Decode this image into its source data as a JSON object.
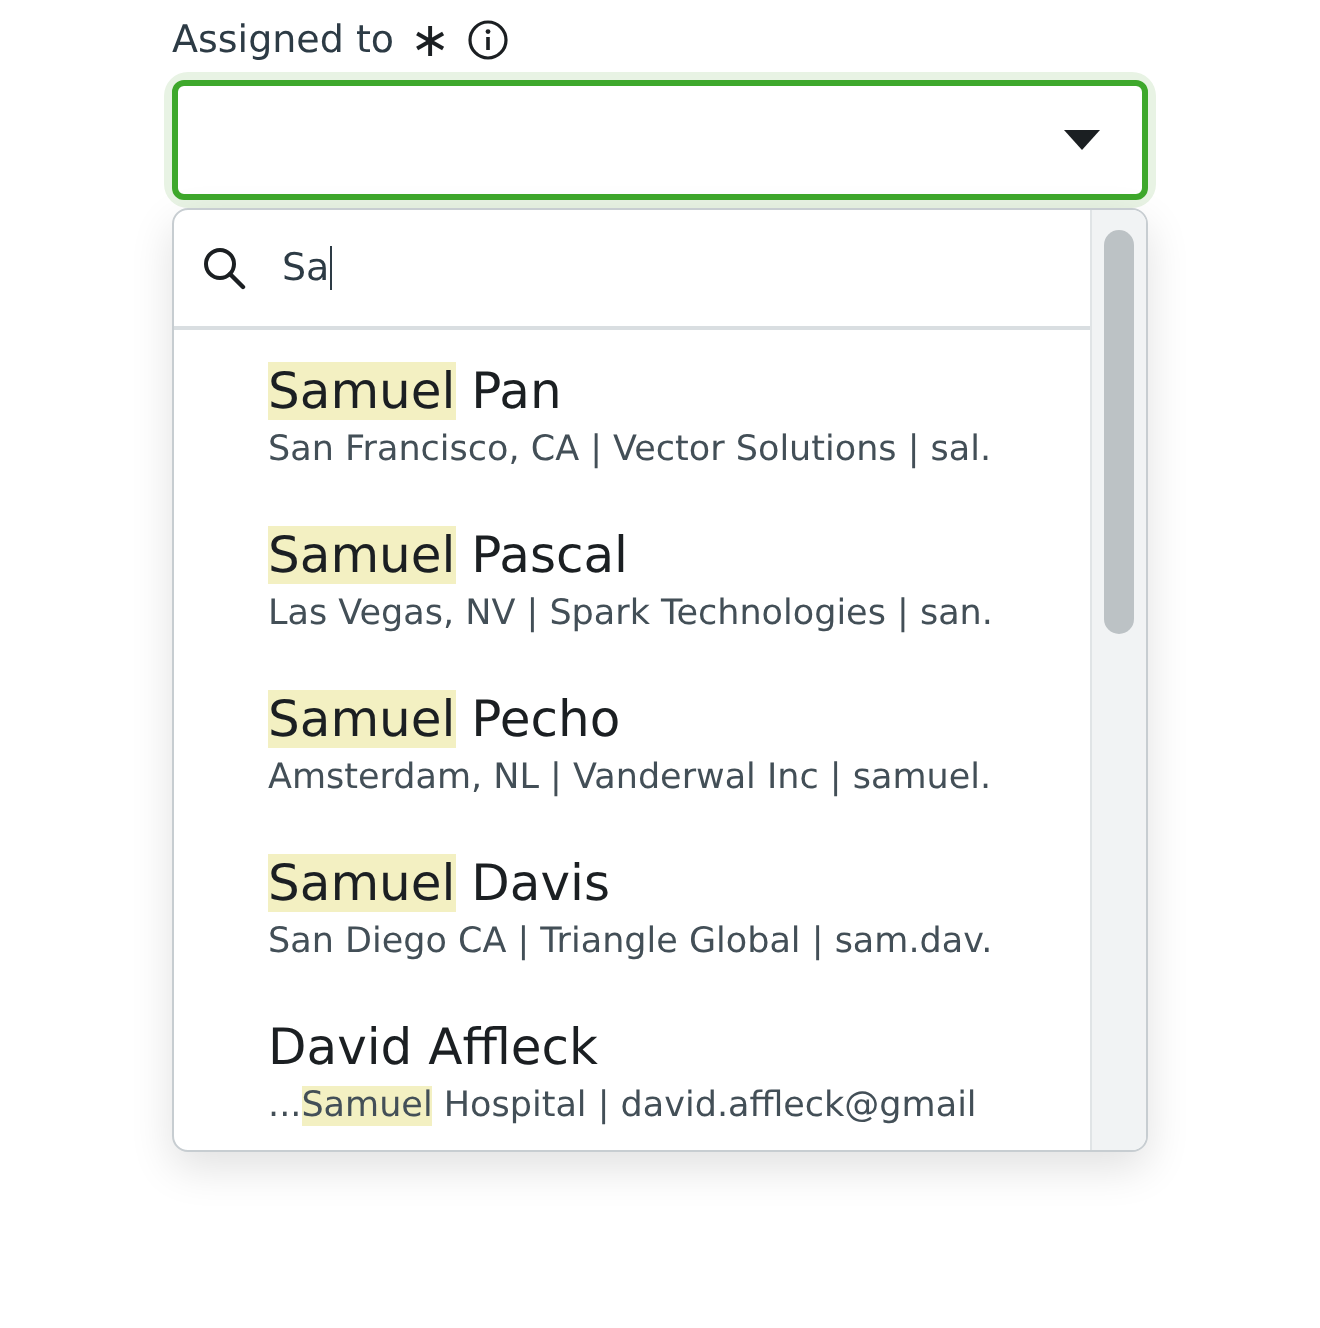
{
  "field": {
    "label": "Assigned to",
    "required_mark": "∗",
    "focused": true
  },
  "dropdown": {
    "search": {
      "value": "Sa"
    },
    "options": [
      {
        "name": [
          {
            "text": "Samuel",
            "highlighted": true
          },
          {
            "text": " Pan",
            "highlighted": false
          }
        ],
        "detail": [
          {
            "text": "San Francisco, CA | Vector Solutions | sal.",
            "highlighted": false
          }
        ]
      },
      {
        "name": [
          {
            "text": "Samuel",
            "highlighted": true
          },
          {
            "text": " Pascal",
            "highlighted": false
          }
        ],
        "detail": [
          {
            "text": "Las Vegas, NV | Spark Technologies | san.",
            "highlighted": false
          }
        ]
      },
      {
        "name": [
          {
            "text": "Samuel",
            "highlighted": true
          },
          {
            "text": " Pecho",
            "highlighted": false
          }
        ],
        "detail": [
          {
            "text": "Amsterdam, NL | Vanderwal Inc | samuel.",
            "highlighted": false
          }
        ]
      },
      {
        "name": [
          {
            "text": "Samuel",
            "highlighted": true
          },
          {
            "text": " Davis",
            "highlighted": false
          }
        ],
        "detail": [
          {
            "text": "San Diego CA | Triangle Global | sam.dav.",
            "highlighted": false
          }
        ]
      },
      {
        "name": [
          {
            "text": "David Affleck",
            "highlighted": false
          }
        ],
        "detail": [
          {
            "text": "...",
            "highlighted": false
          },
          {
            "text": "Samuel",
            "highlighted": true
          },
          {
            "text": " Hospital | david.affleck@gmail",
            "highlighted": false
          }
        ]
      }
    ]
  }
}
